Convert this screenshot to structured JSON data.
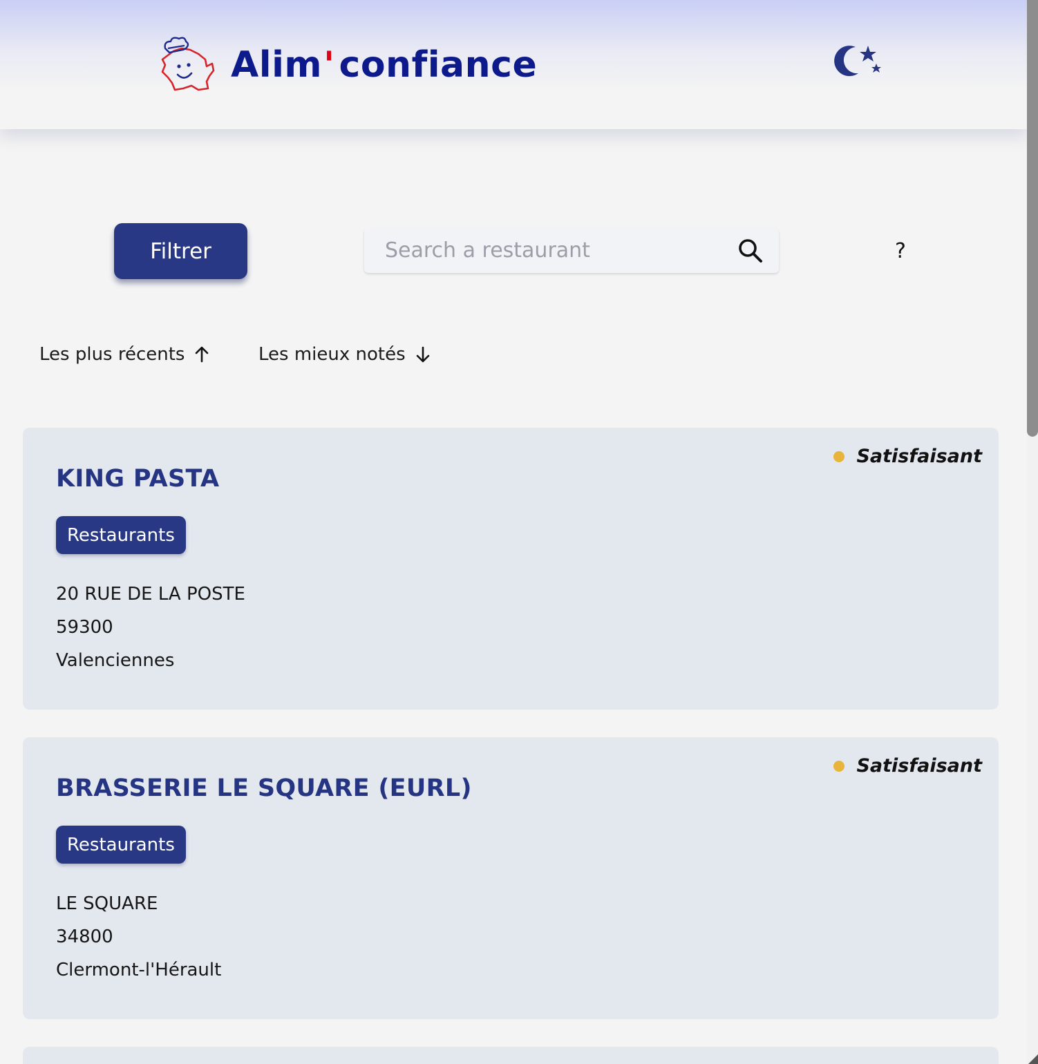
{
  "brand": {
    "name_part1": "Alim",
    "apostrophe": "'",
    "name_part2": "confiance",
    "text_color": "#0d1a8c",
    "accent_color": "#e1000f"
  },
  "header": {
    "logo_icon": "chef-france-mascot-icon",
    "theme_toggle_icon": "moon-stars-icon"
  },
  "toolbar": {
    "filter_label": "Filtrer",
    "search_placeholder": "Search a restaurant",
    "search_value": "",
    "search_icon": "search-icon",
    "help_label": "?"
  },
  "sort": {
    "options": [
      {
        "label": "Les plus récents",
        "direction": "up"
      },
      {
        "label": "Les mieux notés",
        "direction": "down"
      }
    ]
  },
  "results": {
    "items": [
      {
        "name": "KING PASTA",
        "category": "Restaurants",
        "address_line": "20 RUE DE LA POSTE",
        "postal_code": "59300",
        "city": "Valenciennes",
        "rating": "Satisfaisant",
        "rating_color": "#e8b53a"
      },
      {
        "name": "BRASSERIE LE SQUARE (EURL)",
        "category": "Restaurants",
        "address_line": "LE SQUARE",
        "postal_code": "34800",
        "city": "Clermont-l'Hérault",
        "rating": "Satisfaisant",
        "rating_color": "#e8b53a"
      }
    ]
  },
  "colors": {
    "primary": "#283884",
    "card_background": "#e3e7ee",
    "page_background": "#f4f4f4"
  }
}
